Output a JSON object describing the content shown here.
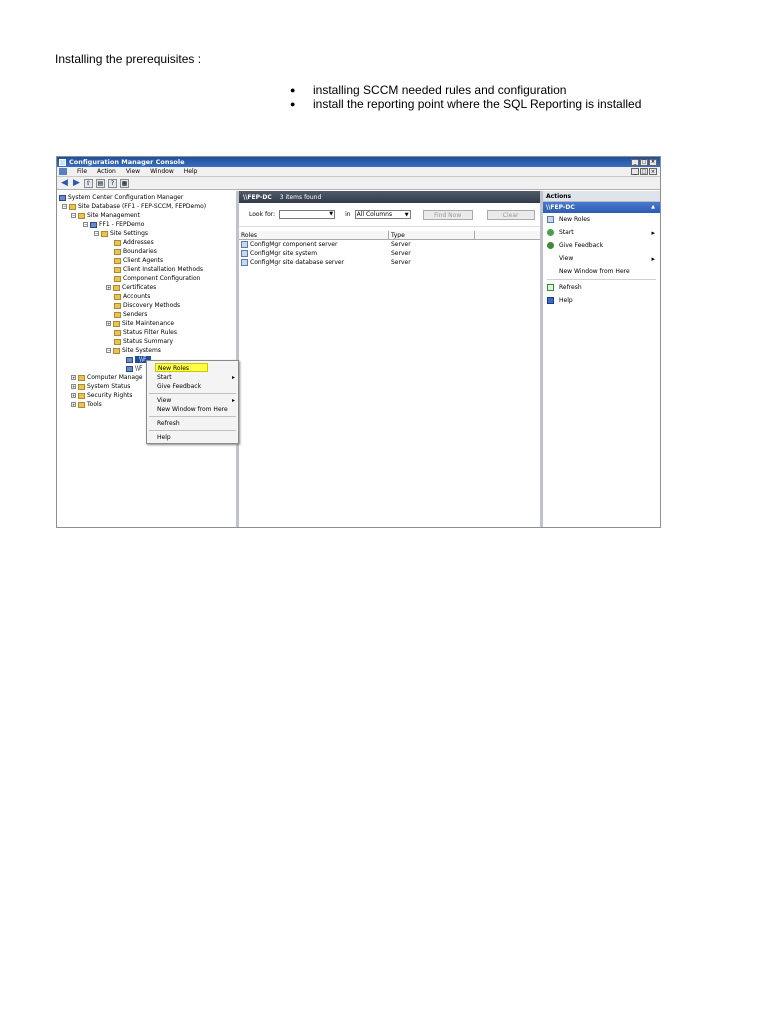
{
  "document": {
    "heading": "Installing the prerequisites :",
    "bullets": [
      "installing SCCM needed rules and configuration",
      "install the reporting point where the SQL Reporting is installed"
    ]
  },
  "window": {
    "title": "Configuration Manager Console",
    "menu": [
      "File",
      "Action",
      "View",
      "Window",
      "Help"
    ]
  },
  "tree": {
    "items": [
      {
        "label": "System Center Configuration Manager"
      },
      {
        "label": "Site Database  (FF1 - FEP-SCCM, FEPDemo)"
      },
      {
        "label": "Site Management"
      },
      {
        "label": "FF1 - FEPDemo"
      },
      {
        "label": "Site Settings"
      },
      {
        "label": "Addresses"
      },
      {
        "label": "Boundaries"
      },
      {
        "label": "Client Agents"
      },
      {
        "label": "Client Installation Methods"
      },
      {
        "label": "Component Configuration"
      },
      {
        "label": "Certificates"
      },
      {
        "label": "Accounts"
      },
      {
        "label": "Discovery Methods"
      },
      {
        "label": "Senders"
      },
      {
        "label": "Site Maintenance"
      },
      {
        "label": "Status Filter Rules"
      },
      {
        "label": "Status Summary"
      },
      {
        "label": "Site Systems"
      },
      {
        "label": "\\\\F"
      },
      {
        "label": "\\\\F"
      },
      {
        "label": "Computer Manage"
      },
      {
        "label": "System Status"
      },
      {
        "label": "Security Rights"
      },
      {
        "label": "Tools"
      }
    ]
  },
  "context_menu": {
    "new_roles": "New Roles",
    "start": "Start",
    "give_feedback": "Give Feedback",
    "view": "View",
    "new_window": "New Window from Here",
    "refresh": "Refresh",
    "help": "Help"
  },
  "center": {
    "title": "\\\\FEP-DC",
    "count": "3 items found",
    "look_for_label": "Look for:",
    "in_label": "in",
    "in_value": "All Columns",
    "find_now": "Find Now",
    "clear": "Clear",
    "columns": [
      "Roles",
      "Type"
    ],
    "rows": [
      {
        "role": "ConfigMgr component server",
        "type": "Server"
      },
      {
        "role": "ConfigMgr site system",
        "type": "Server"
      },
      {
        "role": "ConfigMgr site database server",
        "type": "Server"
      }
    ]
  },
  "actions": {
    "title": "Actions",
    "subtitle": "\\\\FEP-DC",
    "new_roles": "New Roles",
    "start": "Start",
    "give_feedback": "Give Feedback",
    "view": "View",
    "new_window": "New Window from Here",
    "refresh": "Refresh",
    "help": "Help"
  }
}
